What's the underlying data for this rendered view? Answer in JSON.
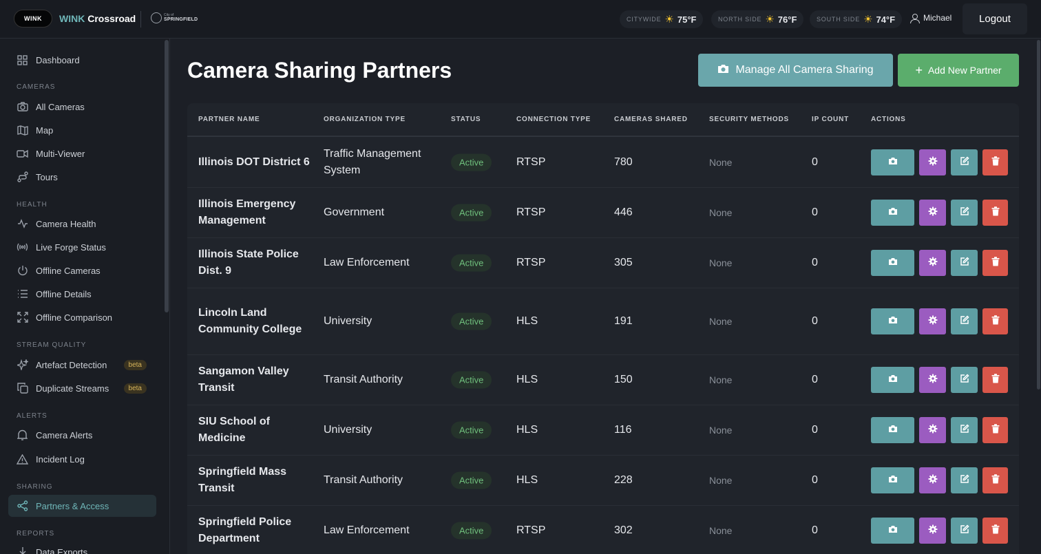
{
  "header": {
    "logo_text": "WINK",
    "brand_accent": "WINK",
    "brand_rest": " Crossroad",
    "city_small": "City of",
    "city_name": "SPRINGFIELD",
    "weather": [
      {
        "label": "CITYWIDE",
        "temp": "75°F"
      },
      {
        "label": "NORTH SIDE",
        "temp": "76°F"
      },
      {
        "label": "SOUTH SIDE",
        "temp": "74°F"
      }
    ],
    "user": "Michael",
    "logout": "Logout"
  },
  "sidebar": {
    "dashboard": "Dashboard",
    "sections": {
      "cameras": "CAMERAS",
      "health": "HEALTH",
      "stream_quality": "STREAM QUALITY",
      "alerts": "ALERTS",
      "sharing": "SHARING",
      "reports": "REPORTS"
    },
    "items": {
      "all_cameras": "All Cameras",
      "map": "Map",
      "multi_viewer": "Multi-Viewer",
      "tours": "Tours",
      "camera_health": "Camera Health",
      "live_forge": "Live Forge Status",
      "offline_cameras": "Offline Cameras",
      "offline_details": "Offline Details",
      "offline_comparison": "Offline Comparison",
      "artefact_detection": "Artefact Detection",
      "duplicate_streams": "Duplicate Streams",
      "camera_alerts": "Camera Alerts",
      "incident_log": "Incident Log",
      "partners_access": "Partners & Access",
      "data_exports": "Data Exports"
    },
    "beta": "beta"
  },
  "main": {
    "title": "Camera Sharing Partners",
    "manage_button": "Manage All Camera Sharing",
    "add_button": "Add New Partner",
    "columns": {
      "partner_name": "PARTNER NAME",
      "org_type": "ORGANIZATION TYPE",
      "status": "STATUS",
      "connection": "CONNECTION TYPE",
      "cameras": "CAMERAS SHARED",
      "security": "SECURITY METHODS",
      "ip_count": "IP COUNT",
      "actions": "ACTIONS"
    },
    "rows": [
      {
        "name": "Illinois DOT District 6",
        "org": "Traffic Management System",
        "status": "Active",
        "conn": "RTSP",
        "cams": "780",
        "sec": "None",
        "ip": "0"
      },
      {
        "name": "Illinois Emergency Management",
        "org": "Government",
        "status": "Active",
        "conn": "RTSP",
        "cams": "446",
        "sec": "None",
        "ip": "0"
      },
      {
        "name": "Illinois State Police Dist. 9",
        "org": "Law Enforcement",
        "status": "Active",
        "conn": "RTSP",
        "cams": "305",
        "sec": "None",
        "ip": "0"
      },
      {
        "name": "Lincoln Land Community College",
        "org": "University",
        "status": "Active",
        "conn": "HLS",
        "cams": "191",
        "sec": "None",
        "ip": "0"
      },
      {
        "name": "Sangamon Valley Transit",
        "org": "Transit Authority",
        "status": "Active",
        "conn": "HLS",
        "cams": "150",
        "sec": "None",
        "ip": "0"
      },
      {
        "name": "SIU School of Medicine",
        "org": "University",
        "status": "Active",
        "conn": "HLS",
        "cams": "116",
        "sec": "None",
        "ip": "0"
      },
      {
        "name": "Springfield Mass Transit",
        "org": "Transit Authority",
        "status": "Active",
        "conn": "HLS",
        "cams": "228",
        "sec": "None",
        "ip": "0"
      },
      {
        "name": "Springfield Police Department",
        "org": "Law Enforcement",
        "status": "Active",
        "conn": "RTSP",
        "cams": "302",
        "sec": "None",
        "ip": "0"
      }
    ]
  }
}
